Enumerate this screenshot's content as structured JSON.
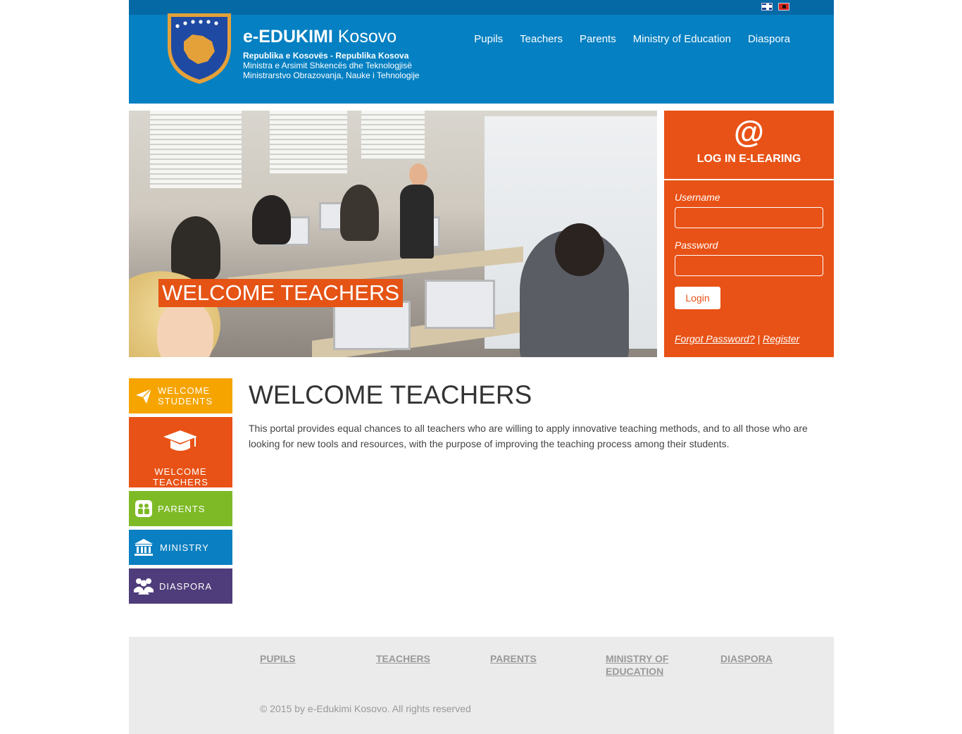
{
  "header": {
    "title_bold": "e-EDUKIMI",
    "title_regular": "Kosovo",
    "line1": "Republika e Kosovës - Republika Kosova",
    "line2": "Ministra e Arsimit Shkencës dhe Teknologjisë",
    "line3": "Ministrarstvo Obrazovanja, Nauke i Tehnologije",
    "nav": [
      "Pupils",
      "Teachers",
      "Parents",
      "Ministry of Education",
      "Diaspora"
    ],
    "flags": [
      "english-flag-icon",
      "albanian-flag-icon"
    ]
  },
  "hero": {
    "caption": "WELCOME TEACHERS"
  },
  "login": {
    "icon": "@",
    "title": "LOG IN E-LEARING",
    "username_label": "Username",
    "password_label": "Password",
    "username_value": "",
    "password_value": "",
    "button": "Login",
    "forgot": "Forgot Password?",
    "separator": "|",
    "register": "Register"
  },
  "sidebar": {
    "items": [
      {
        "label_line1": "WELCOME",
        "label_line2": "STUDENTS",
        "icon": "paper-plane-icon",
        "color": "#f6a400"
      },
      {
        "label_line1": "WELCOME",
        "label_line2": "TEACHERS",
        "icon": "graduation-cap-icon",
        "color": "#e85216"
      },
      {
        "label_line1": "PARENTS",
        "label_line2": "",
        "icon": "family-icon",
        "color": "#7eba26"
      },
      {
        "label_line1": "MINISTRY",
        "label_line2": "",
        "icon": "government-building-icon",
        "color": "#0a7fc1"
      },
      {
        "label_line1": "DIASPORA",
        "label_line2": "",
        "icon": "people-group-icon",
        "color": "#4f3c7a"
      }
    ]
  },
  "main": {
    "title": "WELCOME TEACHERS",
    "text": "This portal provides equal chances to all teachers who are willing to apply innovative teaching methods, and to all those who are looking for new tools and resources, with the purpose of improving the teaching process among their students."
  },
  "footer": {
    "links": [
      "PUPILS",
      "TEACHERS",
      "PARENTS",
      "MINISTRY OF EDUCATION",
      "DIASPORA"
    ],
    "copyright": "© 2015 by e-Edukimi Kosovo. All rights reserved"
  },
  "colors": {
    "header_blue": "#0580c2",
    "topbar_blue": "#0569a5",
    "accent_orange": "#e85216"
  }
}
